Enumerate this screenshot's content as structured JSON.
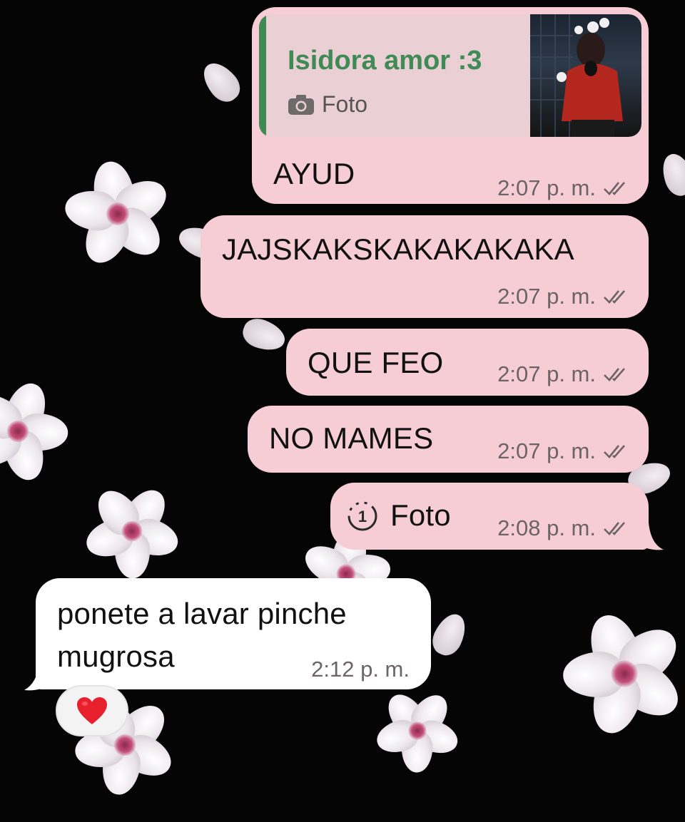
{
  "reply_quote": {
    "sender": "Isidora amor :3",
    "media_label": "Foto",
    "media_icon": "camera-icon"
  },
  "messages": [
    {
      "direction": "out",
      "text": "AYUD",
      "time": "2:07 p. m.",
      "status": "read-double-check"
    },
    {
      "direction": "out",
      "text": "JAJSKAKSKAKAKAKAKA",
      "time": "2:07 p. m.",
      "status": "read-double-check"
    },
    {
      "direction": "out",
      "text": "QUE FEO",
      "time": "2:07 p. m.",
      "status": "read-double-check"
    },
    {
      "direction": "out",
      "text": "NO MAMES",
      "time": "2:07 p. m.",
      "status": "read-double-check"
    },
    {
      "direction": "out",
      "text": "Foto",
      "type": "view-once-photo",
      "icon": "view-once-icon",
      "time": "2:08 p. m.",
      "status": "read-double-check"
    },
    {
      "direction": "in",
      "text_line1": "ponete a lavar pinche",
      "text_line2": "mugrosa",
      "time": "2:12 p. m.",
      "reaction": "❤️"
    }
  ],
  "colors": {
    "outgoing_bubble": "#f6ccd5",
    "incoming_bubble": "#ffffff",
    "quote_accent": "#3f8a55",
    "background": "#050505"
  }
}
